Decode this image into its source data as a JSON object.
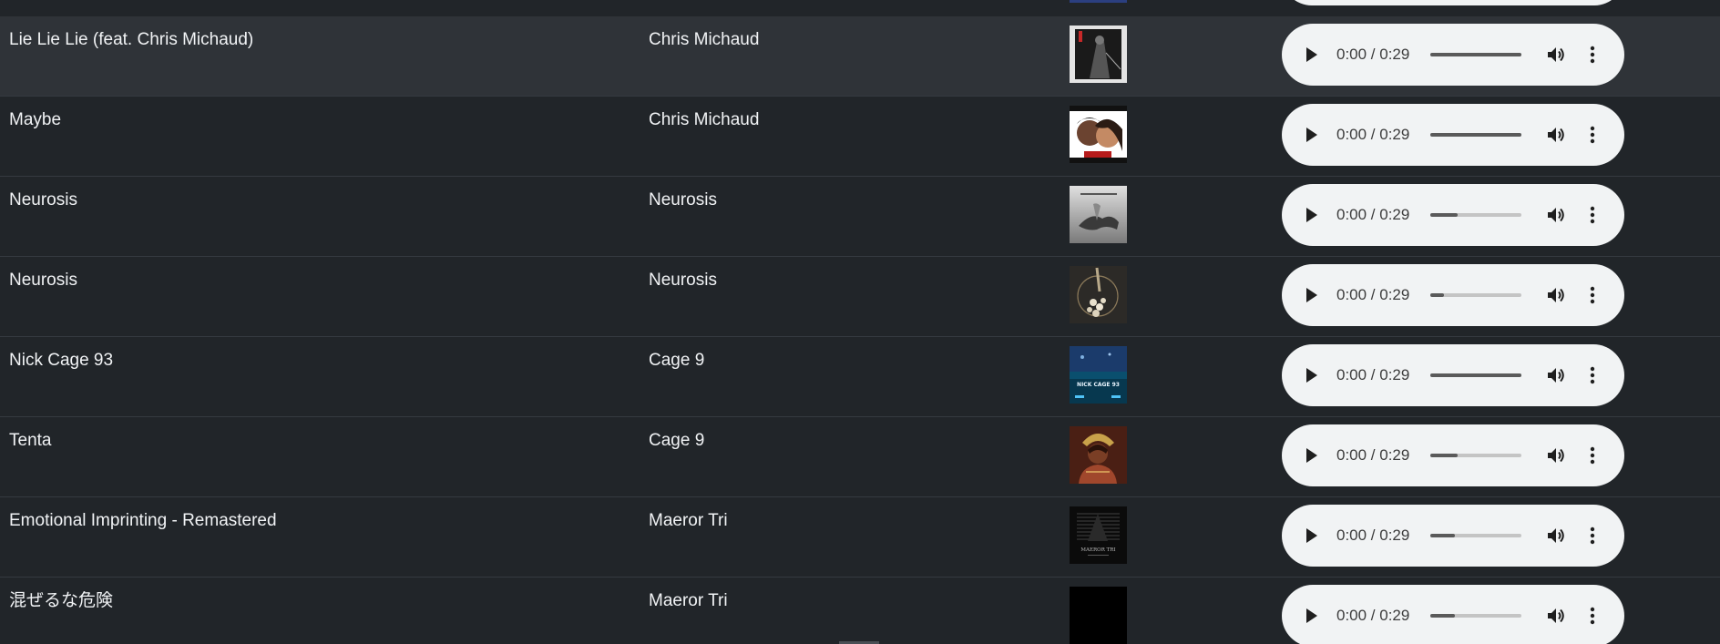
{
  "tracks": [
    {
      "title": "Lie Lie Lie (feat. Chris Michaud)",
      "artist": "Chris Michaud",
      "time": "0:00 / 0:29",
      "seek_progress": 1.0,
      "highlighted": true
    },
    {
      "title": "Maybe",
      "artist": "Chris Michaud",
      "time": "0:00 / 0:29",
      "seek_progress": 1.0
    },
    {
      "title": "Neurosis",
      "artist": "Neurosis",
      "time": "0:00 / 0:29",
      "seek_progress": 0.3
    },
    {
      "title": "Neurosis",
      "artist": "Neurosis",
      "time": "0:00 / 0:29",
      "seek_progress": 0.15
    },
    {
      "title": "Nick Cage 93",
      "artist": "Cage 9",
      "time": "0:00 / 0:29",
      "seek_progress": 1.0,
      "album_art_text": "NICK CAGE 93"
    },
    {
      "title": "Tenta",
      "artist": "Cage 9",
      "time": "0:00 / 0:29",
      "seek_progress": 0.3
    },
    {
      "title": "Emotional Imprinting - Remastered",
      "artist": "Maeror Tri",
      "time": "0:00 / 0:29",
      "seek_progress": 0.27,
      "album_art_text": "MAEROR TRI"
    },
    {
      "title": "混ぜるな危険",
      "artist": "Maeror Tri",
      "time": "0:00 / 0:29",
      "seek_progress": 0.27
    }
  ],
  "icons": {
    "play": "play-icon",
    "volume": "volume-icon",
    "more": "more-vert-icon"
  },
  "colors": {
    "background": "#212529",
    "highlight_row": "#2f3338",
    "player_bg": "#f1f3f4"
  }
}
